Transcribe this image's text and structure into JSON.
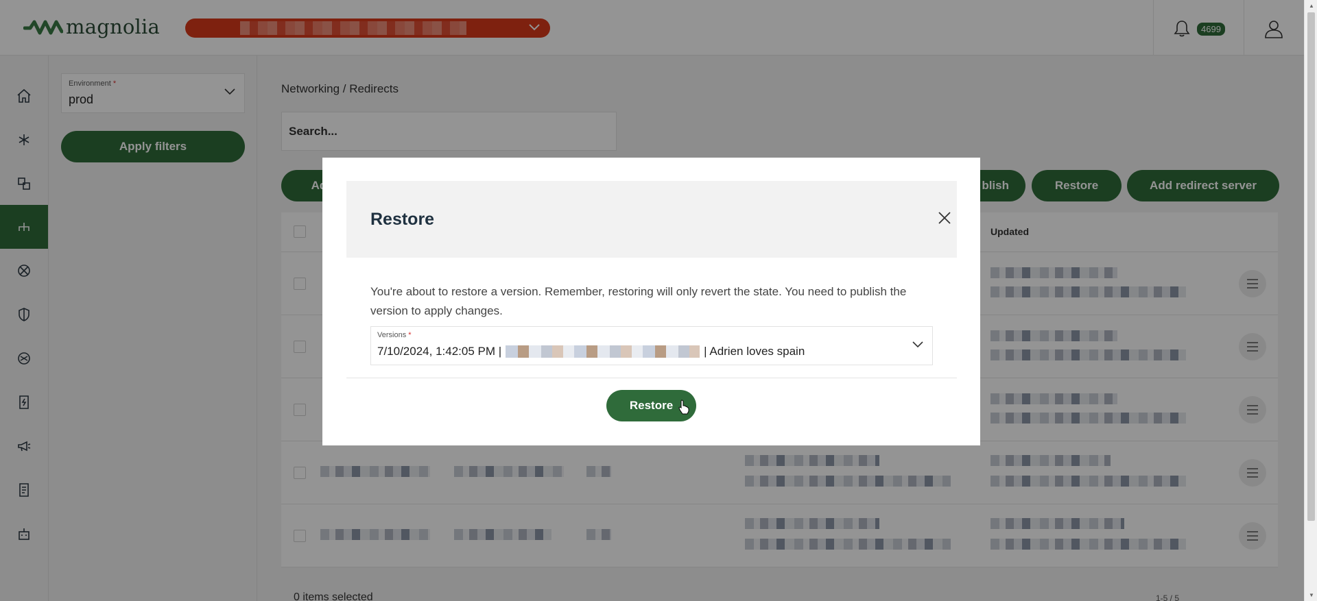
{
  "header": {
    "logo_text": "magnolia",
    "notifications_count": "4699"
  },
  "filters": {
    "environment_label": "Environment",
    "environment_value": "prod",
    "apply_label": "Apply filters"
  },
  "main": {
    "breadcrumb": "Networking / Redirects",
    "search_placeholder": "Search...",
    "toolbar": {
      "add_partial": "Ad",
      "publish_partial": "blish",
      "restore_label": "Restore",
      "add_server_label": "Add redirect server"
    },
    "table": {
      "updated_header": "Updated"
    },
    "footer_selected": "0 items selected",
    "pager": "1-5 / 5"
  },
  "modal": {
    "title": "Restore",
    "message": "You're about to restore a version. Remember, restoring will only revert the state. You need to publish the version to apply changes.",
    "versions_label": "Versions",
    "version_date": "7/10/2024, 1:42:05 PM |",
    "version_note": "| Adrien loves spain",
    "restore_button": "Restore"
  },
  "colors": {
    "brand_green": "#2f6b3a",
    "org_selector_red": "#d93a1a"
  }
}
